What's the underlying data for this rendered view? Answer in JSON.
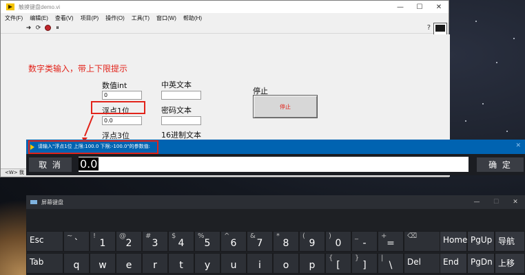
{
  "lv_window": {
    "title": "触摸键盘demo.vi",
    "controls": [
      "—",
      "☐",
      "✕"
    ],
    "menu": [
      "文件(F)",
      "编辑(E)",
      "查看(V)",
      "项目(P)",
      "操作(O)",
      "工具(T)",
      "窗口(W)",
      "帮助(H)"
    ],
    "toolbar": {
      "run": "➜",
      "run_continuous": "⟳",
      "pause": "⏸",
      "help": "?"
    },
    "heading": "数字类输入，带上下限提示",
    "labels": {
      "int_label": "数值int",
      "float1_label": "浮点1位",
      "float3_label": "浮点3位",
      "cn_en_label": "中英文本",
      "password_label": "密码文本",
      "hex_label": "16进制文本",
      "stop_label": "停止"
    },
    "values": {
      "int_value": "0",
      "float1_value": "0.0"
    },
    "stop_button": "停止",
    "status": "<W> 我"
  },
  "input_bar": {
    "prompt": "请输入\"浮点1位 上限:100.0 下限:-100.0\"的参数值:",
    "close": "✕",
    "cancel": "取 消",
    "value": "0.0",
    "ok": "确 定"
  },
  "keyboard": {
    "title": "屏幕键盘",
    "controls": [
      "—",
      "☐",
      "✕"
    ],
    "row1": [
      {
        "main": "Esc",
        "up": ""
      },
      {
        "main": "`",
        "up": "~"
      },
      {
        "main": "1",
        "up": "!"
      },
      {
        "main": "2",
        "up": "@"
      },
      {
        "main": "3",
        "up": "#"
      },
      {
        "main": "4",
        "up": "$"
      },
      {
        "main": "5",
        "up": "%"
      },
      {
        "main": "6",
        "up": "^"
      },
      {
        "main": "7",
        "up": "&"
      },
      {
        "main": "8",
        "up": "*"
      },
      {
        "main": "9",
        "up": "("
      },
      {
        "main": "0",
        "up": ")"
      },
      {
        "main": "-",
        "up": "_"
      },
      {
        "main": "=",
        "up": "+"
      },
      {
        "main": "",
        "up": "⌫"
      }
    ],
    "row2": [
      {
        "main": "Tab",
        "up": ""
      },
      {
        "main": "q",
        "up": ""
      },
      {
        "main": "w",
        "up": ""
      },
      {
        "main": "e",
        "up": ""
      },
      {
        "main": "r",
        "up": ""
      },
      {
        "main": "t",
        "up": ""
      },
      {
        "main": "y",
        "up": ""
      },
      {
        "main": "u",
        "up": ""
      },
      {
        "main": "i",
        "up": ""
      },
      {
        "main": "o",
        "up": ""
      },
      {
        "main": "p",
        "up": ""
      },
      {
        "main": "[",
        "up": "{"
      },
      {
        "main": "]",
        "up": "}"
      },
      {
        "main": "\\",
        "up": "|"
      },
      {
        "main": "Del",
        "up": ""
      }
    ],
    "nav_row1": [
      "Home",
      "PgUp",
      "导航"
    ],
    "nav_row2": [
      "End",
      "PgDn",
      "上移"
    ]
  },
  "colors": {
    "accent_red": "#e2231a",
    "prompt_blue": "#0063b1",
    "key_bg": "#2d3036"
  }
}
